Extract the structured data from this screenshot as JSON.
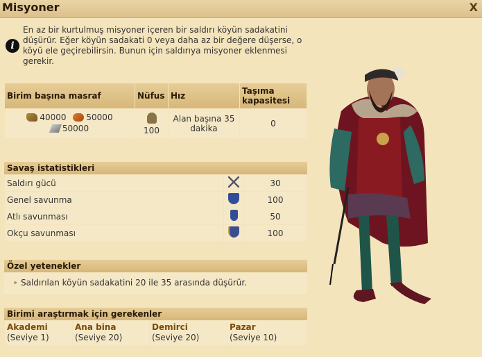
{
  "window": {
    "title": "Misyoner",
    "close_label": "X"
  },
  "info": {
    "text": "En az bir kurtulmuş misyoner içeren bir saldırı köyün sadakatini düşürür. Eğer köyün sadakati 0 veya daha az bir değere düşerse, o köyü ele geçirebilirsin. Bunun için saldırıya misyoner eklenmesi gerekir."
  },
  "cost_table": {
    "headers": [
      "Birim başına masraf",
      "Nüfus",
      "Hız",
      "Taşıma kapasitesi"
    ],
    "wood": "40000",
    "clay": "50000",
    "iron": "50000",
    "population": "100",
    "speed": "Alan başına 35 dakika",
    "capacity": "0"
  },
  "stats": {
    "heading": "Savaş istatistikleri",
    "rows": [
      {
        "label": "Saldırı gücü",
        "icon": "sword-icon",
        "value": "30"
      },
      {
        "label": "Genel savunma",
        "icon": "shield-icon",
        "value": "100"
      },
      {
        "label": "Atlı savunması",
        "icon": "cavalry-shield-icon",
        "value": "50"
      },
      {
        "label": "Okçu savunması",
        "icon": "archer-shield-icon",
        "value": "100"
      }
    ]
  },
  "skills": {
    "heading": "Özel yetenekler",
    "items": [
      "Saldırılan köyün sadakatini 20 ile 35 arasında düşürür."
    ]
  },
  "requirements": {
    "heading": "Birimi araştırmak için gerekenler",
    "buildings": [
      {
        "name": "Akademi",
        "level": "(Seviye 1)"
      },
      {
        "name": "Ana bina",
        "level": "(Seviye 20)"
      },
      {
        "name": "Demirci",
        "level": "(Seviye 20)"
      },
      {
        "name": "Pazar",
        "level": "(Seviye 10)"
      }
    ]
  },
  "colors": {
    "background": "#f4e4bc",
    "header": "#d6b77a",
    "cell": "#f5e8c6",
    "link": "#7a4a08"
  }
}
